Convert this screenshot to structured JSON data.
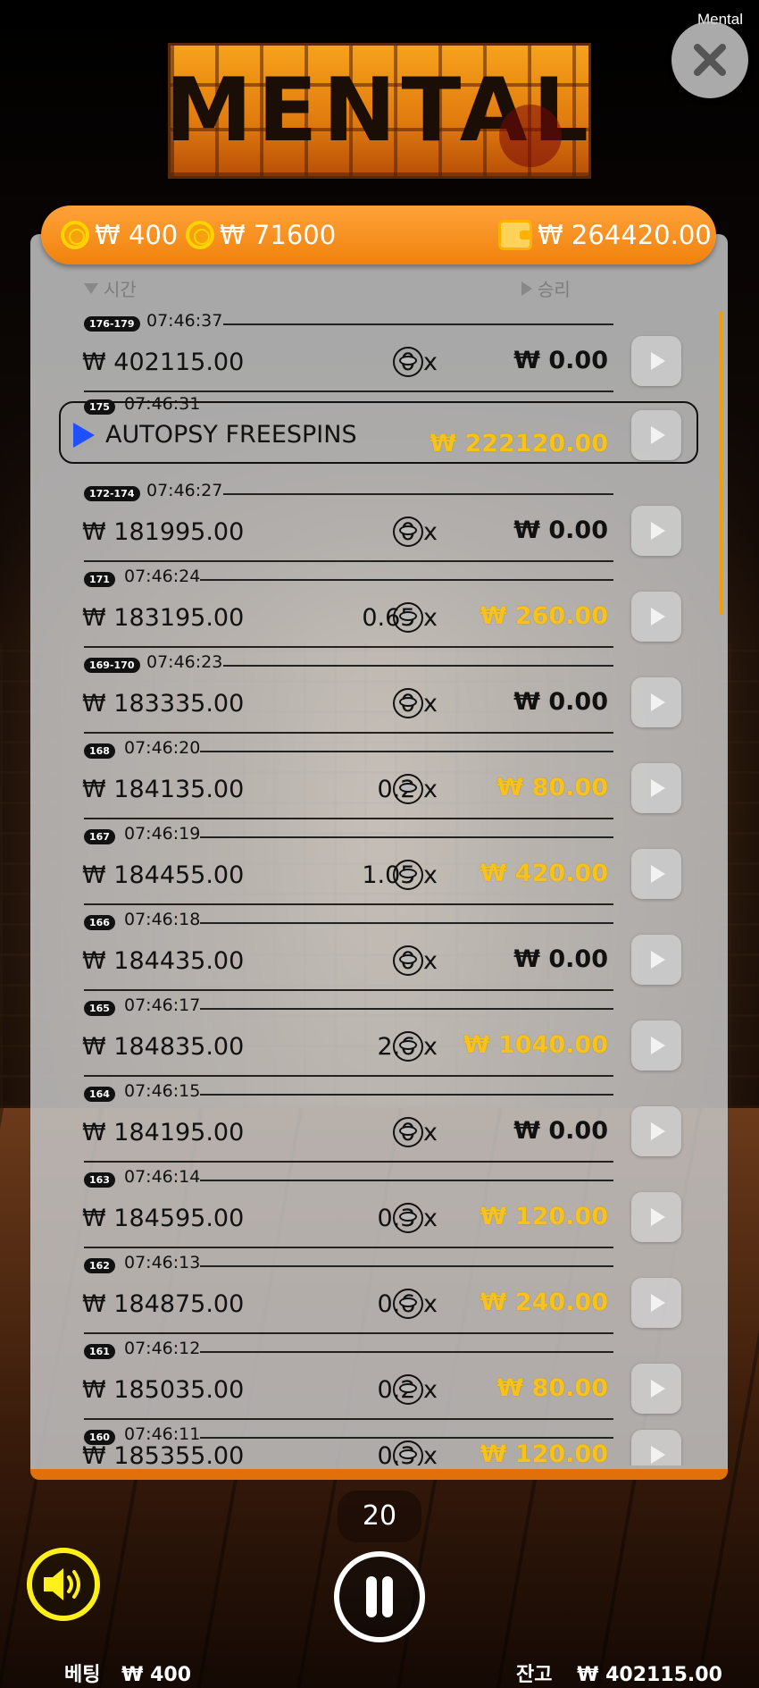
{
  "app": {
    "game_name": "Mental",
    "logo_text": "MENTAL"
  },
  "topbar": {
    "bet_value": "₩ 400",
    "coin_value": "₩ 71600",
    "wallet_value": "₩ 264420.00"
  },
  "columns": {
    "time": "시간",
    "win": "승리"
  },
  "rows": [
    {
      "badge": "176-179",
      "time": "07:46:37",
      "bet": "₩ 402115.00",
      "mult": "0 x",
      "win": "₩ 0.00",
      "positive": false
    },
    {
      "badge": "175",
      "time": "07:46:31",
      "label": "AUTOPSY FREESPINS",
      "win": "₩ 222120.00",
      "positive": true
    },
    {
      "badge": "172-174",
      "time": "07:46:27",
      "bet": "₩ 181995.00",
      "mult": "0 x",
      "win": "₩ 0.00",
      "positive": false
    },
    {
      "badge": "171",
      "time": "07:46:24",
      "bet": "₩ 183195.00",
      "mult": "0.65 x",
      "win": "₩ 260.00",
      "positive": true
    },
    {
      "badge": "169-170",
      "time": "07:46:23",
      "bet": "₩ 183335.00",
      "mult": "0 x",
      "win": "₩ 0.00",
      "positive": false
    },
    {
      "badge": "168",
      "time": "07:46:20",
      "bet": "₩ 184135.00",
      "mult": "0.2 x",
      "win": "₩ 80.00",
      "positive": true
    },
    {
      "badge": "167",
      "time": "07:46:19",
      "bet": "₩ 184455.00",
      "mult": "1.05 x",
      "win": "₩ 420.00",
      "positive": true
    },
    {
      "badge": "166",
      "time": "07:46:18",
      "bet": "₩ 184435.00",
      "mult": "0 x",
      "win": "₩ 0.00",
      "positive": false
    },
    {
      "badge": "165",
      "time": "07:46:17",
      "bet": "₩ 184835.00",
      "mult": "2.6 x",
      "win": "₩ 1040.00",
      "positive": true
    },
    {
      "badge": "164",
      "time": "07:46:15",
      "bet": "₩ 184195.00",
      "mult": "0 x",
      "win": "₩ 0.00",
      "positive": false
    },
    {
      "badge": "163",
      "time": "07:46:14",
      "bet": "₩ 184595.00",
      "mult": "0.3 x",
      "win": "₩ 120.00",
      "positive": true
    },
    {
      "badge": "162",
      "time": "07:46:13",
      "bet": "₩ 184875.00",
      "mult": "0.6 x",
      "win": "₩ 240.00",
      "positive": true
    },
    {
      "badge": "161",
      "time": "07:46:12",
      "bet": "₩ 185035.00",
      "mult": "0.2 x",
      "win": "₩ 80.00",
      "positive": true
    },
    {
      "badge": "160",
      "time": "07:46:11",
      "bet": "₩ 185355.00",
      "mult": "0.3 x",
      "win": "₩ 120.00",
      "positive": true
    }
  ],
  "controls": {
    "spins_left": "20"
  },
  "footer": {
    "bet_label": "베팅",
    "bet_value": "₩ 400",
    "balance_label": "잔고",
    "balance_value": "₩ 402115.00"
  },
  "colors": {
    "accent": "#f0820c",
    "win": "#f7c21a",
    "sound": "#fff01a",
    "play_indicator": "#1f4fff"
  }
}
